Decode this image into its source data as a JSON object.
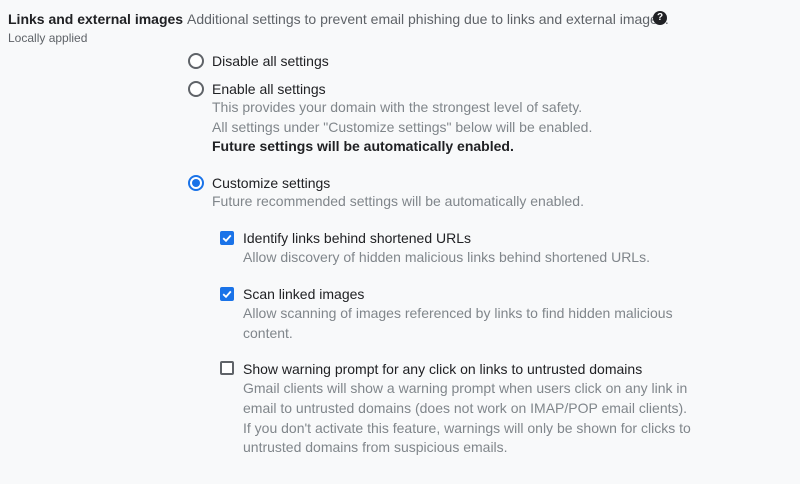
{
  "section": {
    "title": "Links and external images",
    "status": "Locally applied",
    "description": "Additional settings to prevent email phishing due to links and external images.",
    "help_icon": "?"
  },
  "options": {
    "disable_all": {
      "label": "Disable all settings",
      "selected": false
    },
    "enable_all": {
      "label": "Enable all settings",
      "selected": false,
      "help_line1": "This provides your domain with the strongest level of safety.",
      "help_line2": "All settings under \"Customize settings\" below will be enabled.",
      "help_strong": "Future settings will be automatically enabled."
    },
    "customize": {
      "label": "Customize settings",
      "selected": true,
      "help": "Future recommended settings will be automatically enabled."
    }
  },
  "checkboxes": {
    "shortened_urls": {
      "label": "Identify links behind shortened URLs",
      "checked": true,
      "help": "Allow discovery of hidden malicious links behind shortened URLs."
    },
    "linked_images": {
      "label": "Scan linked images",
      "checked": true,
      "help_line1": "Allow scanning of images referenced by links to find hidden malicious",
      "help_line2": "content."
    },
    "warning_prompt": {
      "label": "Show warning prompt for any click on links to untrusted domains",
      "checked": false,
      "help_line1": "Gmail clients will show a warning prompt when users click on any link in",
      "help_line2": "email to untrusted domains (does not work on IMAP/POP email clients).",
      "help_line3": "If you don't activate this feature, warnings will only be shown for clicks to",
      "help_line4": "untrusted domains from suspicious emails."
    }
  },
  "colors": {
    "accent": "#1a73e8",
    "text_primary": "#202124",
    "text_secondary": "#80868b",
    "background": "#f8f9fa"
  },
  "icons": {
    "help": "help-circle-icon",
    "check": "checkmark-icon"
  }
}
